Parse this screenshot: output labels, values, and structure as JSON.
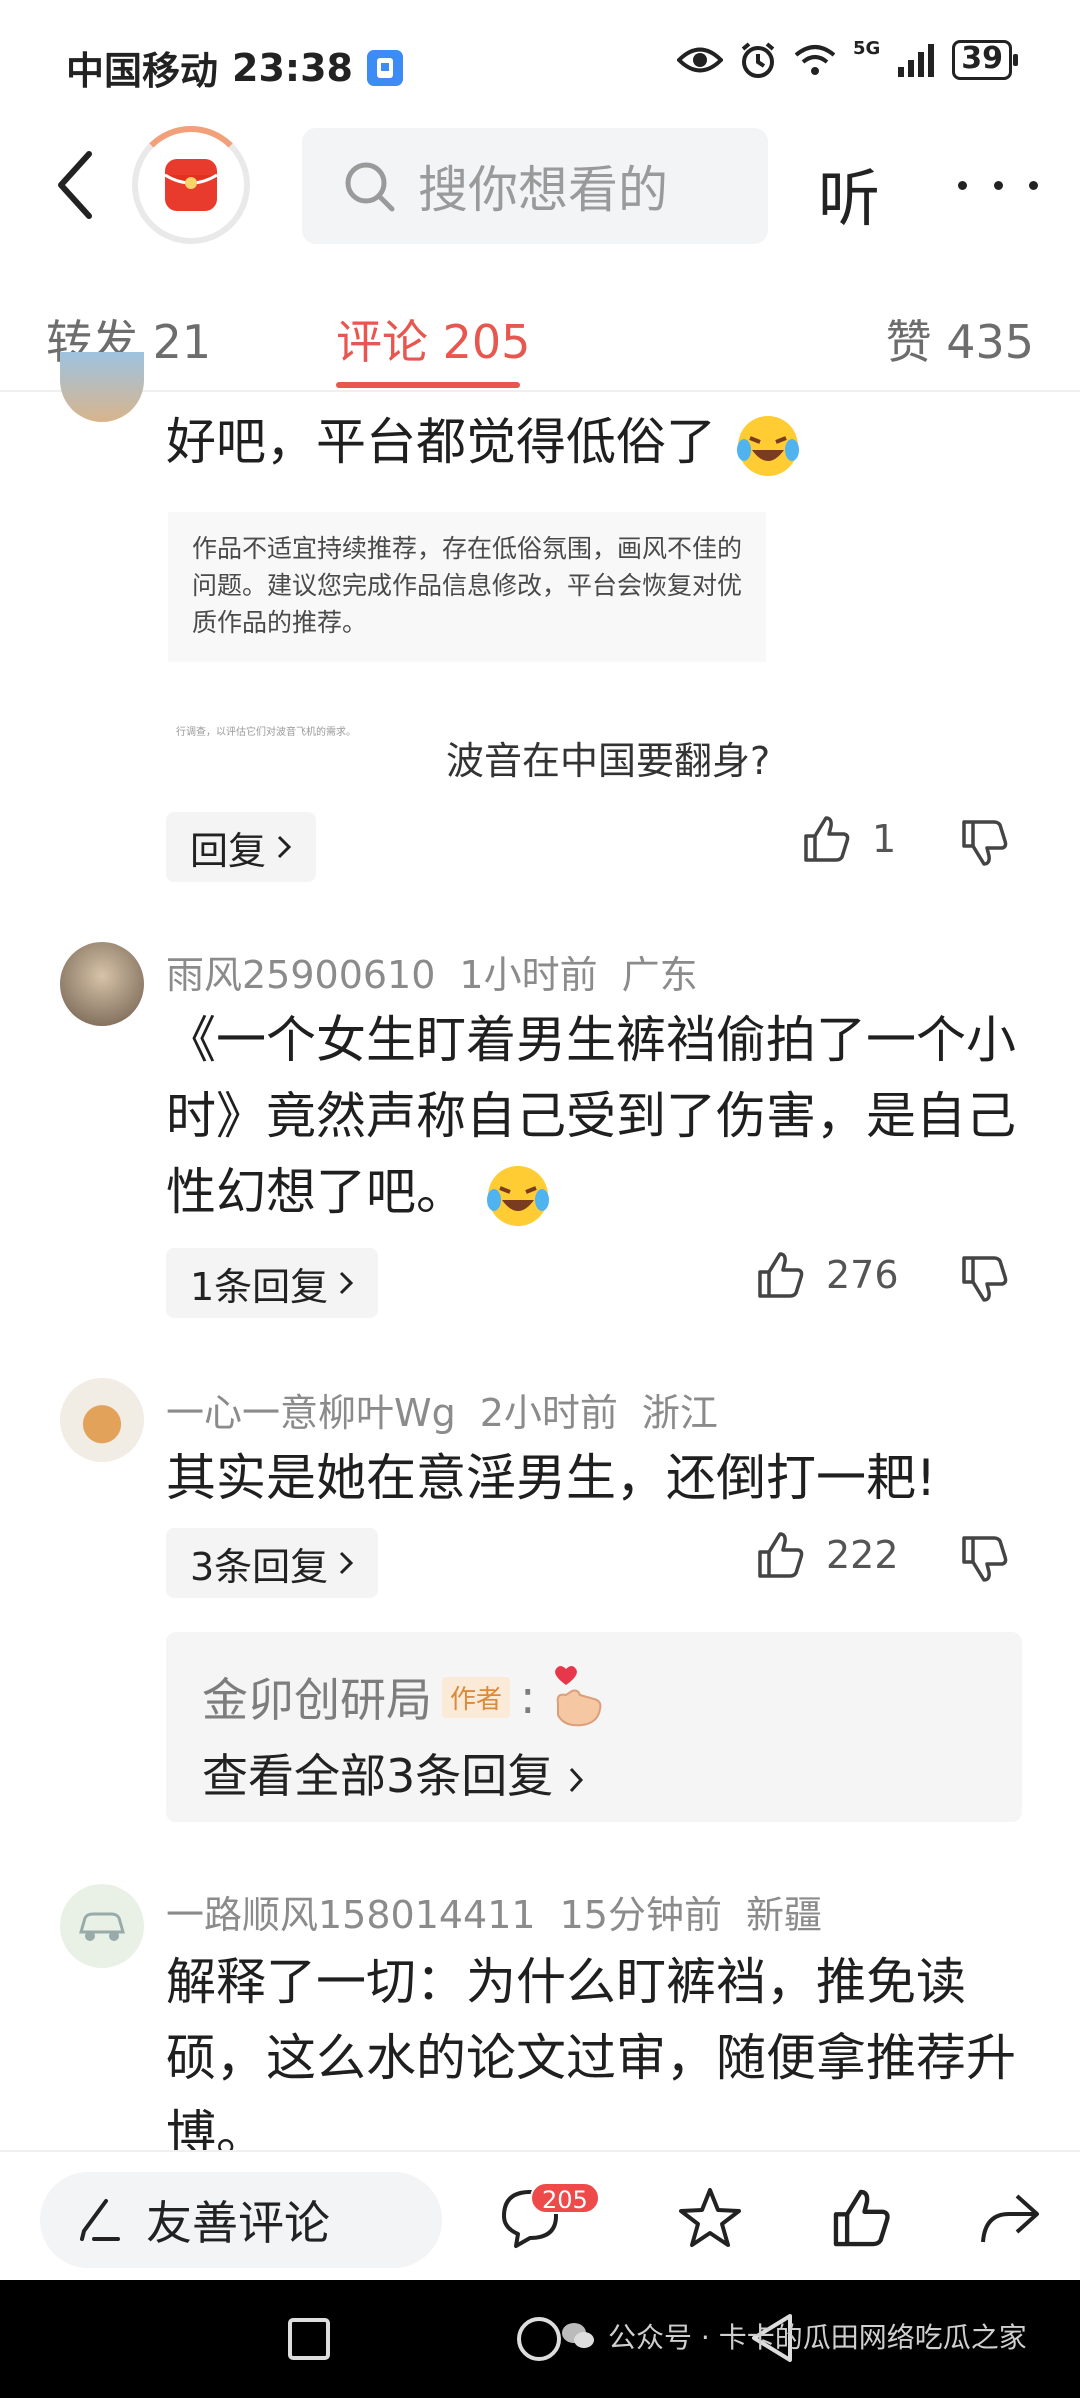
{
  "status": {
    "carrier": "中国移动",
    "time": "23:38",
    "network": "5G",
    "battery": "39"
  },
  "header": {
    "search_placeholder": "搜你想看的",
    "listen_label": "听"
  },
  "tabs": [
    {
      "label": "转发 21"
    },
    {
      "label": "评论 205"
    },
    {
      "label": "赞 435"
    }
  ],
  "comment0": {
    "text": "好吧，平台都觉得低俗了",
    "notice": "作品不适宜持续推荐，存在低俗氛围，画风不佳的问题。建议您完成作品信息修改，平台会恢复对优质作品的推荐。",
    "thumb_text": "行调查，以评估它们对波音飞机的需求。",
    "linked_text": "波音在中国要翻身?",
    "reply_label": "回复",
    "likes": "1"
  },
  "comment1": {
    "user": "雨风25900610",
    "time": "1小时前",
    "region": "广东",
    "text": "《一个女生盯着男生裤裆偷拍了一个小时》竟然声称自己受到了伤害，是自己性幻想了吧。",
    "reply_label": "1条回复",
    "likes": "276"
  },
  "comment2": {
    "user": "一心一意柳叶Wg",
    "time": "2小时前",
    "region": "浙江",
    "text": "其实是她在意淫男生，还倒打一耙!",
    "reply_label": "3条回复",
    "likes": "222",
    "author_name": "金卯创研局",
    "author_tag": "作者",
    "author_colon": ":",
    "view_all": "查看全部3条回复"
  },
  "comment3": {
    "user": "一路顺风158014411",
    "time": "15分钟前",
    "region": "新疆",
    "text": "解释了一切：为什么盯裤裆，推免读硕，这么水的论文过审，随便拿推荐升博。"
  },
  "bottom": {
    "compose_label": "友善评论",
    "comment_count": "205"
  },
  "watermark": "公众号 · 卡卡的瓜田网络吃瓜之家",
  "colors": {
    "accent": "#e7574f",
    "badge": "#ef4a4a"
  }
}
